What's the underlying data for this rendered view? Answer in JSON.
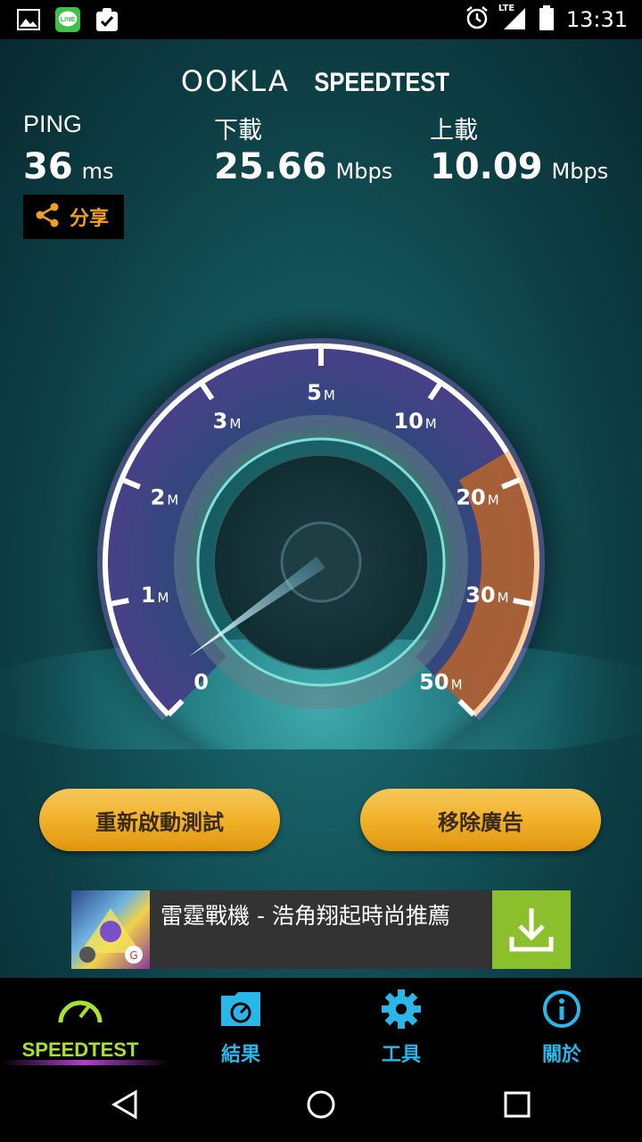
{
  "status_bar": {
    "time": "13:31",
    "network": "LTE",
    "icons": [
      "image-icon",
      "line-app-icon",
      "clipboard-check-icon",
      "alarm-icon",
      "signal-icon",
      "battery-icon"
    ]
  },
  "header": {
    "logo_ookla": "OOKLA",
    "logo_speedtest": "SPEEDTEST"
  },
  "metrics": {
    "ping_label": "PING",
    "ping_value": "36",
    "ping_unit": "ms",
    "download_label": "下載",
    "download_value": "25.66",
    "download_unit": "Mbps",
    "upload_label": "上載",
    "upload_value": "10.09",
    "upload_unit": "Mbps"
  },
  "share": {
    "label": "分享"
  },
  "gauge": {
    "ticks": [
      {
        "n": "0",
        "u": ""
      },
      {
        "n": "1",
        "u": "M"
      },
      {
        "n": "2",
        "u": "M"
      },
      {
        "n": "3",
        "u": "M"
      },
      {
        "n": "5",
        "u": "M"
      },
      {
        "n": "10",
        "u": "M"
      },
      {
        "n": "20",
        "u": "M"
      },
      {
        "n": "30",
        "u": "M"
      },
      {
        "n": "50",
        "u": "M"
      }
    ]
  },
  "buttons": {
    "restart": "重新啟動測試",
    "remove_ads": "移除廣告"
  },
  "ad": {
    "text": "雷霆戰機 - 浩角翔起時尚推薦"
  },
  "nav": {
    "items": [
      {
        "label": "SPEEDTEST",
        "color": "#a6e22e"
      },
      {
        "label": "結果",
        "color": "#29b6e8"
      },
      {
        "label": "工具",
        "color": "#29b6e8"
      },
      {
        "label": "關於",
        "color": "#29b6e8"
      }
    ]
  },
  "colors": {
    "accent_orange": "#f0a020",
    "speedtest_green": "#a6e22e",
    "nav_blue": "#29b6e8",
    "button_gold": "#f2b42e"
  }
}
